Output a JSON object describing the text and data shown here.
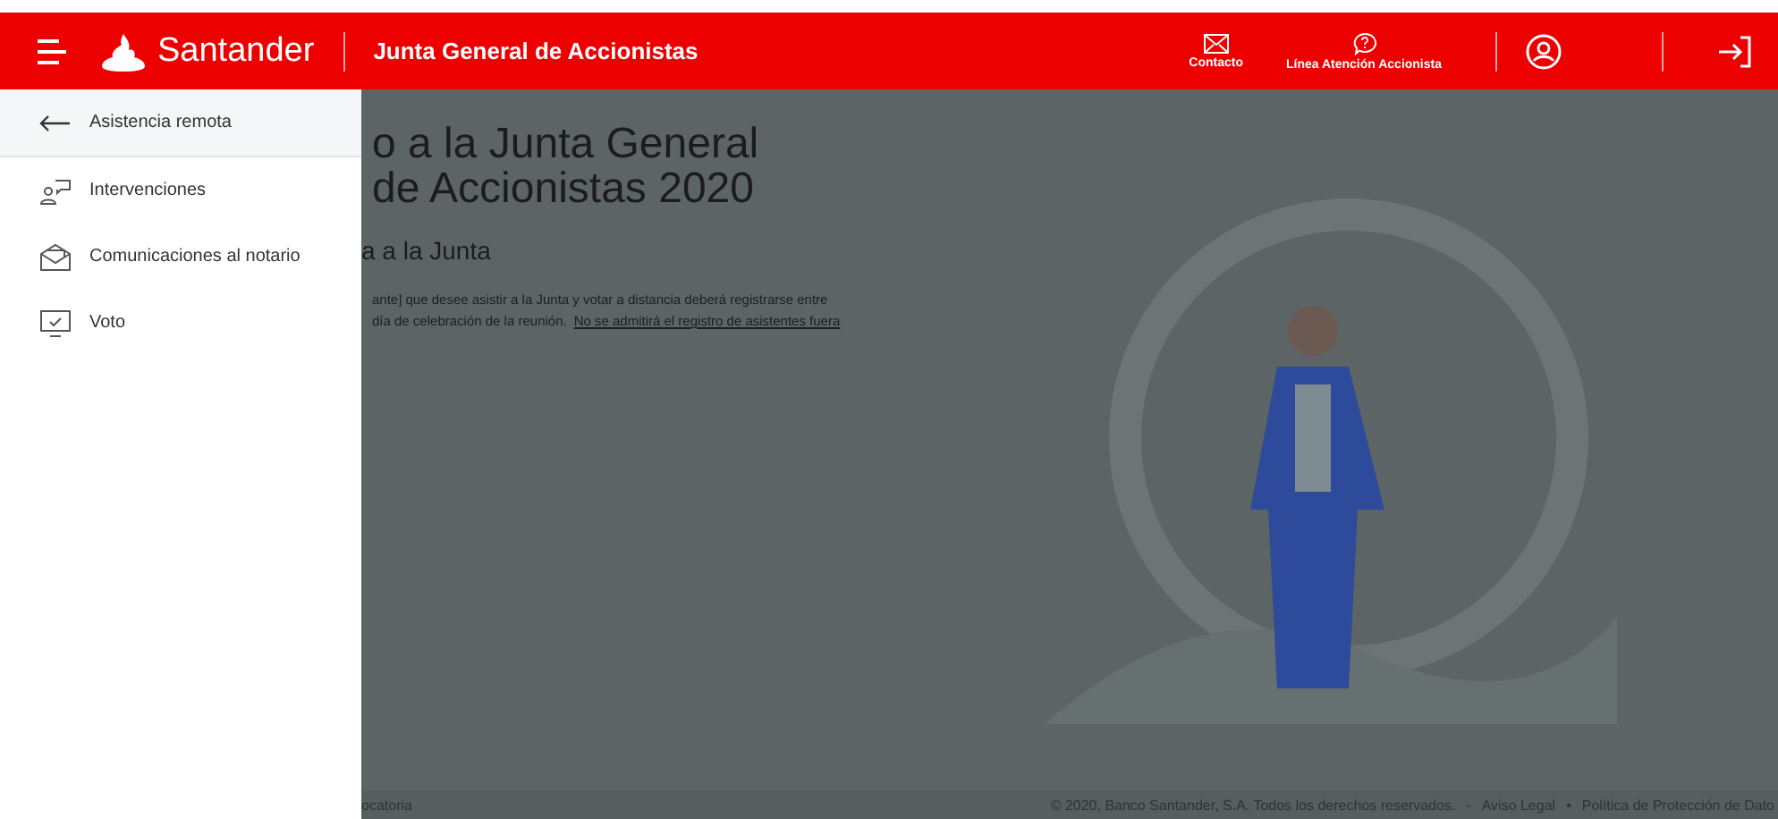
{
  "header": {
    "brand": "Santander",
    "title": "Junta General de Accionistas",
    "actions": [
      {
        "kind": "mail",
        "label": "Contacto"
      },
      {
        "kind": "help",
        "label": "Línea Atención Accionista"
      }
    ]
  },
  "sidebar": {
    "items": [
      {
        "kind": "back",
        "label": "Asistencia remota",
        "selected": true
      },
      {
        "kind": "speech",
        "label": "Intervenciones",
        "selected": false
      },
      {
        "kind": "mail",
        "label": "Comunicaciones al notario",
        "selected": false
      },
      {
        "kind": "vote",
        "label": "Voto",
        "selected": false
      }
    ]
  },
  "main": {
    "title_lines": [
      "o a la Junta General",
      "de Accionistas 2020"
    ],
    "subtitle": "a a la Junta",
    "paragraph_lines": [
      "ante] que desee asistir a la Junta y votar a distancia deberá registrarse entre",
      "día de celebración de la reunión."
    ],
    "link": "No se admitirá el registro de asistentes fuera"
  },
  "footer": {
    "left": "ocatoria",
    "copyright": "© 2020, Banco Santander, S.A. Todos los derechos reservados.",
    "sep1": "-",
    "legal": "Aviso Legal",
    "sep2": "•",
    "privacy": "Política de Protección de Dato"
  }
}
